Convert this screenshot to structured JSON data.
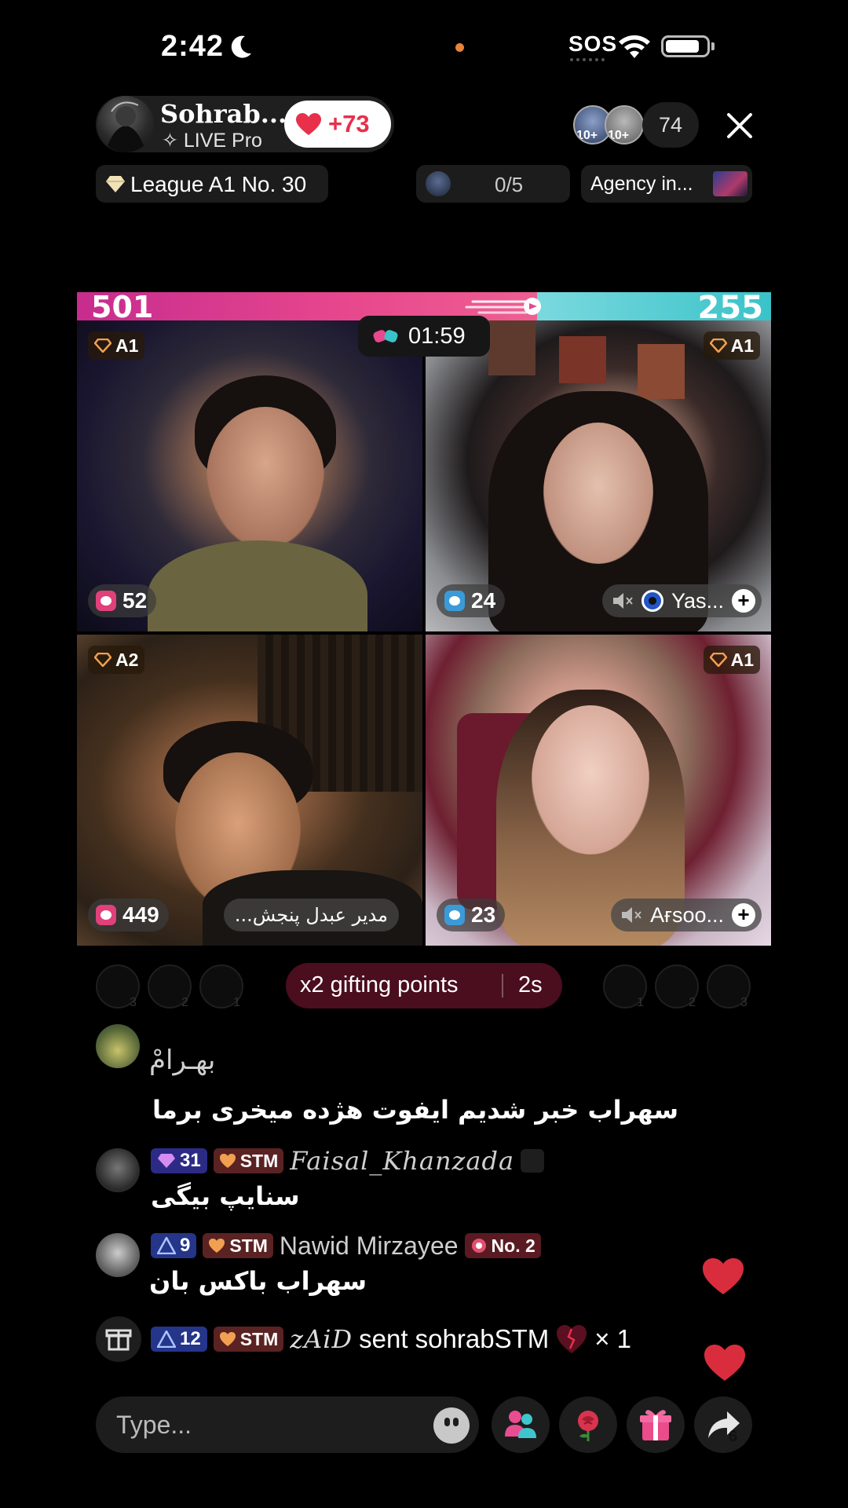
{
  "status_bar": {
    "time": "2:42",
    "sos": "SOS"
  },
  "host": {
    "name": "Sohrab...",
    "subtitle": "✧ LIVE Pro",
    "likes": "+73"
  },
  "viewers": {
    "badge_1": "10+",
    "badge_2": "10+",
    "count": "74"
  },
  "league": {
    "label": "League A1 No. 30"
  },
  "slots": {
    "label": "0/5"
  },
  "agency": {
    "label": "Agency in..."
  },
  "battle": {
    "left_score": 501,
    "right_score": 255,
    "timer": "01:59",
    "left_color": "#e8488d",
    "right_color": "#4fcbd0"
  },
  "tiles": [
    {
      "rank": "A1",
      "coins": "52",
      "coin_color": "#e0417a"
    },
    {
      "rank": "A1",
      "coins": "24",
      "coin_color": "#3a9bd8",
      "name": "Yas..."
    },
    {
      "rank": "A2",
      "coins": "449",
      "coin_color": "#e0417a",
      "name": "مدیر عبدل پنجش..."
    },
    {
      "rank": "A1",
      "coins": "23",
      "coin_color": "#3a9bd8",
      "name": "Aғsoo..."
    }
  ],
  "gifting_strip": {
    "left_ranks": [
      "3",
      "2",
      "1"
    ],
    "right_ranks": [
      "1",
      "2",
      "3"
    ],
    "label": "x2 gifting points",
    "timer": "2s"
  },
  "chat": [
    {
      "user": "بهـرامْ",
      "message": "سهراب خبر شدیم ایفوت هژده میخری برما"
    },
    {
      "level": "31",
      "club": "STM",
      "user": "Faisal_Khanzada",
      "message": "سنایپ بیگی"
    },
    {
      "level": "9",
      "club": "STM",
      "user": "Nawid Mirzayee",
      "badge": "No. 2",
      "message": "سهراب باکس بان"
    }
  ],
  "gift_event": {
    "level": "12",
    "club": "STM",
    "user": "zAiD",
    "text": "sent sohrabSTM",
    "count": "× 1"
  },
  "composer": {
    "placeholder": "Type...",
    "share_count": "6"
  },
  "icons": [
    "moon-icon",
    "wifi-icon",
    "battery-icon",
    "heart-icon",
    "close-icon",
    "diamond-icon",
    "mute-icon",
    "plus-icon",
    "gift-icon",
    "emoji-icon",
    "people-icon",
    "rose-icon",
    "present-icon",
    "share-icon"
  ]
}
